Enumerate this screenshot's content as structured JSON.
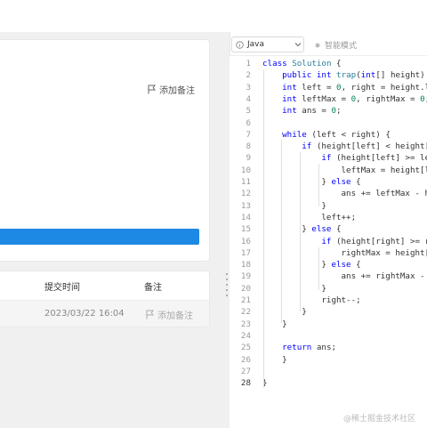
{
  "left": {
    "add_note": "添加备注",
    "table": {
      "headers": [
        "提交时间",
        "备注"
      ],
      "rows": [
        {
          "time": "2023/03/22 16:04",
          "note": "添加备注"
        }
      ]
    }
  },
  "editor": {
    "language": "Java",
    "mode": "智能模式",
    "line_numbers": [
      "1",
      "2",
      "3",
      "4",
      "5",
      "6",
      "7",
      "8",
      "9",
      "10",
      "11",
      "12",
      "13",
      "14",
      "15",
      "16",
      "17",
      "18",
      "19",
      "20",
      "21",
      "22",
      "23",
      "24",
      "25",
      "26",
      "27",
      "28"
    ],
    "code": [
      "class Solution {",
      "    public int trap(int[] height) {",
      "    int left = 0, right = height.le",
      "    int leftMax = 0, rightMax = 0;",
      "    int ans = 0;",
      "",
      "    while (left < right) {",
      "        if (height[left] < height[ri",
      "            if (height[left] >= lef",
      "                leftMax = height[le",
      "            } else {",
      "                ans += leftMax - he",
      "            }",
      "            left++;",
      "        } else {",
      "            if (height[right] >= ri",
      "                rightMax = height[r",
      "            } else {",
      "                ans += rightMax - h",
      "            }",
      "            right--;",
      "        }",
      "    }",
      "",
      "    return ans;",
      "    }",
      "",
      "}"
    ]
  },
  "watermark": "@稀土掘金技术社区",
  "colors": {
    "keyword": "#0000ff",
    "type": "#267f99",
    "accent": "#1e88e5"
  }
}
